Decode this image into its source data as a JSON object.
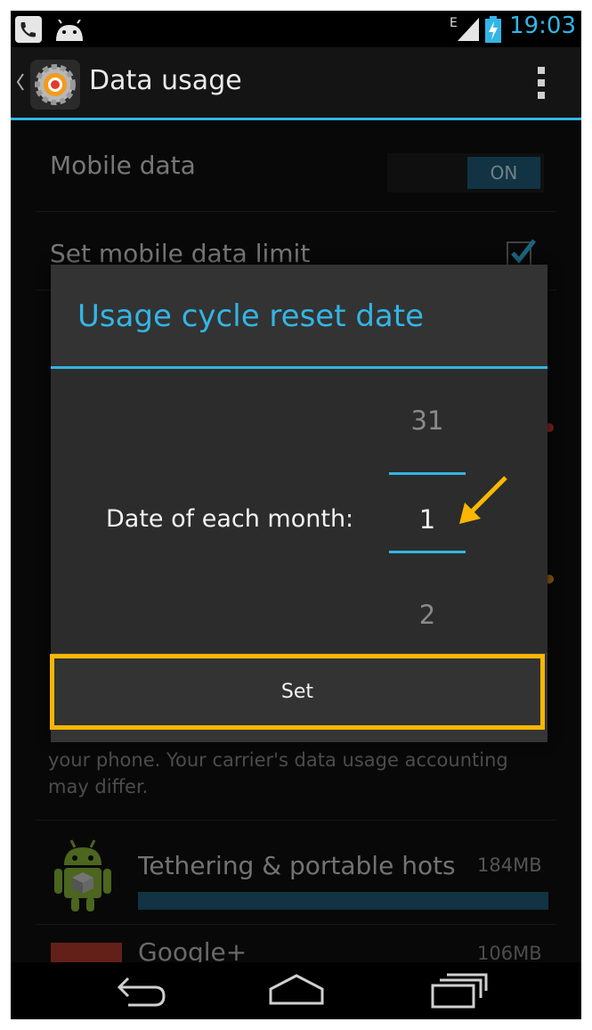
{
  "status_bar": {
    "time": "19:03",
    "network_type": "E",
    "icons": [
      "notification-phone-icon",
      "android-notification-icon",
      "signal-icon",
      "battery-charging-icon"
    ]
  },
  "action_bar": {
    "title": "Data usage",
    "icons": [
      "back-caret-icon",
      "settings-gear-icon",
      "overflow-menu-icon"
    ]
  },
  "settings": {
    "mobile_data_label": "Mobile data",
    "mobile_data_switch": "ON",
    "data_limit_label": "Set mobile data limit",
    "data_limit_checked": true,
    "note_text_line1": "your phone. Your carrier's data usage accounting",
    "note_text_line2": "may differ.",
    "apps": [
      {
        "name": "Tethering & portable hots",
        "usage": "184MB",
        "bar_fraction": 1.0
      },
      {
        "name": "Google+",
        "usage": "106MB"
      }
    ]
  },
  "dialog": {
    "title": "Usage cycle reset date",
    "picker_label": "Date of each month:",
    "picker_prev": "31",
    "picker_value": "1",
    "picker_next": "2",
    "set_button": "Set"
  },
  "colors": {
    "accent": "#33b5e5",
    "highlight": "#f9b701"
  }
}
